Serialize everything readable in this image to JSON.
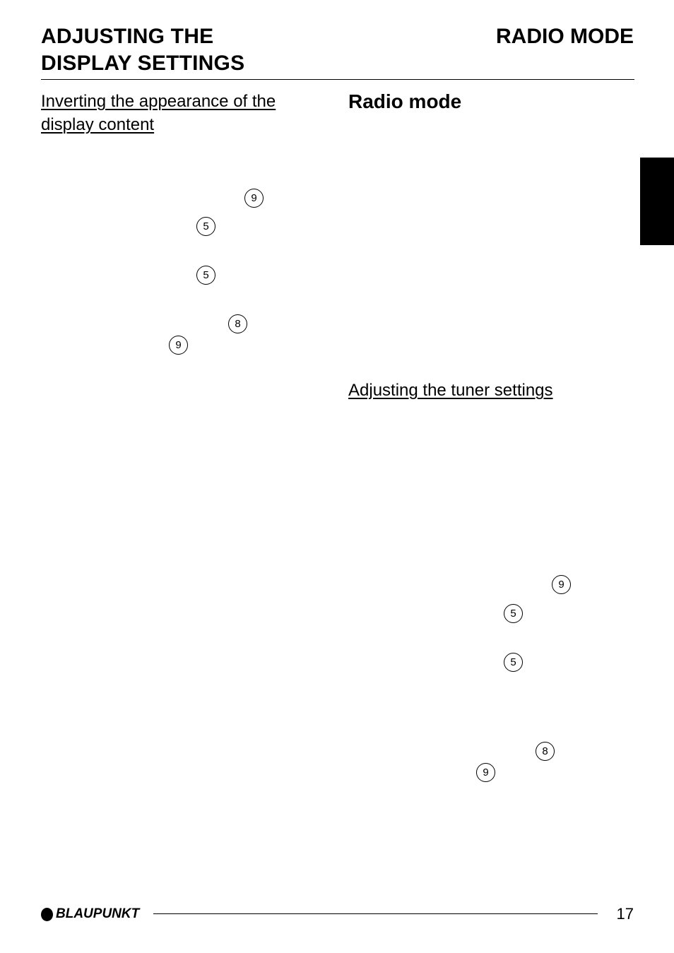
{
  "header": {
    "left_title_line1": "ADJUSTING THE",
    "left_title_line2": "DISPLAY SETTINGS",
    "right_title": "RADIO MODE"
  },
  "left_column": {
    "subheading": "Inverting the appearance of the display content",
    "reference_markers": [
      "9",
      "5",
      "5",
      "8",
      "9"
    ]
  },
  "right_column": {
    "section_title": "Radio mode",
    "subheading": "Adjusting the tuner settings",
    "reference_markers": [
      "9",
      "5",
      "5",
      "8",
      "9"
    ]
  },
  "footer": {
    "brand": "BLAUPUNKT",
    "page_number": "17"
  },
  "colors": {
    "text": "#000000",
    "background": "#ffffff",
    "tab_marker": "#000000"
  }
}
